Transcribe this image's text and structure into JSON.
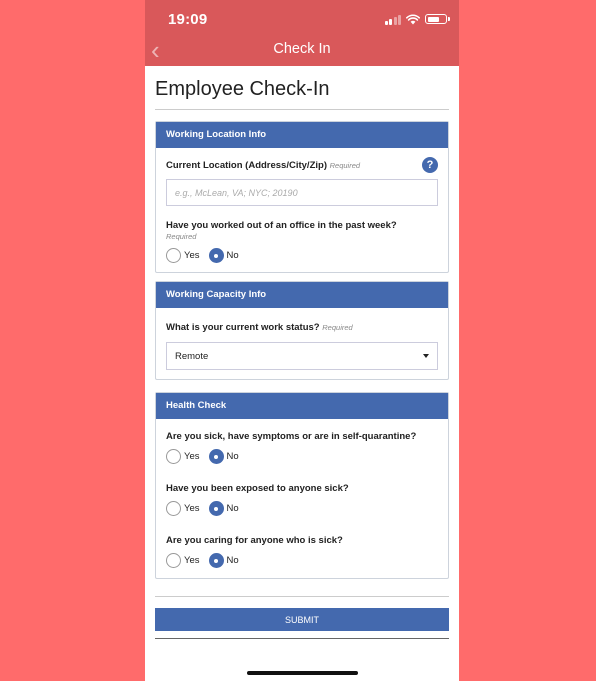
{
  "status": {
    "time": "19:09"
  },
  "nav": {
    "title": "Check In"
  },
  "page": {
    "title": "Employee Check-In"
  },
  "sections": {
    "location": {
      "header": "Working Location Info",
      "current_location_label": "Current Location (Address/City/Zip)",
      "required": "Required",
      "placeholder": "e.g., McLean, VA; NYC; 20190",
      "office_question": "Have you worked out of an office in the past week?",
      "office_yes": "Yes",
      "office_no": "No"
    },
    "capacity": {
      "header": "Working Capacity Info",
      "status_question": "What is your current work status?",
      "required": "Required",
      "status_value": "Remote"
    },
    "health": {
      "header": "Health Check",
      "q1": "Are you sick, have symptoms or are in self-quarantine?",
      "q2": "Have you been exposed to anyone sick?",
      "q3": "Are you caring for anyone who is sick?",
      "yes": "Yes",
      "no": "No"
    }
  },
  "submit_label": "SUBMIT",
  "icons": {
    "back": "chevron-left-icon",
    "help": "question-circle-icon",
    "signal": "signal-icon",
    "wifi": "wifi-icon",
    "battery": "battery-icon"
  },
  "colors": {
    "background": "#ff6b6b",
    "header_bar": "#d9585a",
    "accent": "#4469ae"
  }
}
